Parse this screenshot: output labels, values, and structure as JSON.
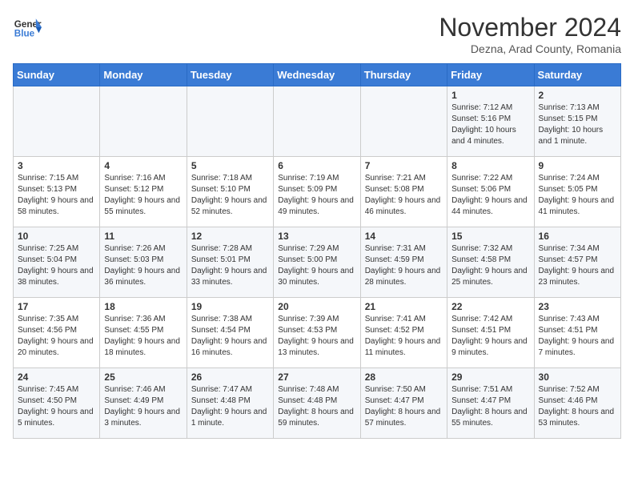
{
  "logo": {
    "general": "General",
    "blue": "Blue"
  },
  "header": {
    "month": "November 2024",
    "location": "Dezna, Arad County, Romania"
  },
  "weekdays": [
    "Sunday",
    "Monday",
    "Tuesday",
    "Wednesday",
    "Thursday",
    "Friday",
    "Saturday"
  ],
  "weeks": [
    [
      {
        "day": "",
        "info": ""
      },
      {
        "day": "",
        "info": ""
      },
      {
        "day": "",
        "info": ""
      },
      {
        "day": "",
        "info": ""
      },
      {
        "day": "",
        "info": ""
      },
      {
        "day": "1",
        "info": "Sunrise: 7:12 AM\nSunset: 5:16 PM\nDaylight: 10 hours and 4 minutes."
      },
      {
        "day": "2",
        "info": "Sunrise: 7:13 AM\nSunset: 5:15 PM\nDaylight: 10 hours and 1 minute."
      }
    ],
    [
      {
        "day": "3",
        "info": "Sunrise: 7:15 AM\nSunset: 5:13 PM\nDaylight: 9 hours and 58 minutes."
      },
      {
        "day": "4",
        "info": "Sunrise: 7:16 AM\nSunset: 5:12 PM\nDaylight: 9 hours and 55 minutes."
      },
      {
        "day": "5",
        "info": "Sunrise: 7:18 AM\nSunset: 5:10 PM\nDaylight: 9 hours and 52 minutes."
      },
      {
        "day": "6",
        "info": "Sunrise: 7:19 AM\nSunset: 5:09 PM\nDaylight: 9 hours and 49 minutes."
      },
      {
        "day": "7",
        "info": "Sunrise: 7:21 AM\nSunset: 5:08 PM\nDaylight: 9 hours and 46 minutes."
      },
      {
        "day": "8",
        "info": "Sunrise: 7:22 AM\nSunset: 5:06 PM\nDaylight: 9 hours and 44 minutes."
      },
      {
        "day": "9",
        "info": "Sunrise: 7:24 AM\nSunset: 5:05 PM\nDaylight: 9 hours and 41 minutes."
      }
    ],
    [
      {
        "day": "10",
        "info": "Sunrise: 7:25 AM\nSunset: 5:04 PM\nDaylight: 9 hours and 38 minutes."
      },
      {
        "day": "11",
        "info": "Sunrise: 7:26 AM\nSunset: 5:03 PM\nDaylight: 9 hours and 36 minutes."
      },
      {
        "day": "12",
        "info": "Sunrise: 7:28 AM\nSunset: 5:01 PM\nDaylight: 9 hours and 33 minutes."
      },
      {
        "day": "13",
        "info": "Sunrise: 7:29 AM\nSunset: 5:00 PM\nDaylight: 9 hours and 30 minutes."
      },
      {
        "day": "14",
        "info": "Sunrise: 7:31 AM\nSunset: 4:59 PM\nDaylight: 9 hours and 28 minutes."
      },
      {
        "day": "15",
        "info": "Sunrise: 7:32 AM\nSunset: 4:58 PM\nDaylight: 9 hours and 25 minutes."
      },
      {
        "day": "16",
        "info": "Sunrise: 7:34 AM\nSunset: 4:57 PM\nDaylight: 9 hours and 23 minutes."
      }
    ],
    [
      {
        "day": "17",
        "info": "Sunrise: 7:35 AM\nSunset: 4:56 PM\nDaylight: 9 hours and 20 minutes."
      },
      {
        "day": "18",
        "info": "Sunrise: 7:36 AM\nSunset: 4:55 PM\nDaylight: 9 hours and 18 minutes."
      },
      {
        "day": "19",
        "info": "Sunrise: 7:38 AM\nSunset: 4:54 PM\nDaylight: 9 hours and 16 minutes."
      },
      {
        "day": "20",
        "info": "Sunrise: 7:39 AM\nSunset: 4:53 PM\nDaylight: 9 hours and 13 minutes."
      },
      {
        "day": "21",
        "info": "Sunrise: 7:41 AM\nSunset: 4:52 PM\nDaylight: 9 hours and 11 minutes."
      },
      {
        "day": "22",
        "info": "Sunrise: 7:42 AM\nSunset: 4:51 PM\nDaylight: 9 hours and 9 minutes."
      },
      {
        "day": "23",
        "info": "Sunrise: 7:43 AM\nSunset: 4:51 PM\nDaylight: 9 hours and 7 minutes."
      }
    ],
    [
      {
        "day": "24",
        "info": "Sunrise: 7:45 AM\nSunset: 4:50 PM\nDaylight: 9 hours and 5 minutes."
      },
      {
        "day": "25",
        "info": "Sunrise: 7:46 AM\nSunset: 4:49 PM\nDaylight: 9 hours and 3 minutes."
      },
      {
        "day": "26",
        "info": "Sunrise: 7:47 AM\nSunset: 4:48 PM\nDaylight: 9 hours and 1 minute."
      },
      {
        "day": "27",
        "info": "Sunrise: 7:48 AM\nSunset: 4:48 PM\nDaylight: 8 hours and 59 minutes."
      },
      {
        "day": "28",
        "info": "Sunrise: 7:50 AM\nSunset: 4:47 PM\nDaylight: 8 hours and 57 minutes."
      },
      {
        "day": "29",
        "info": "Sunrise: 7:51 AM\nSunset: 4:47 PM\nDaylight: 8 hours and 55 minutes."
      },
      {
        "day": "30",
        "info": "Sunrise: 7:52 AM\nSunset: 4:46 PM\nDaylight: 8 hours and 53 minutes."
      }
    ]
  ]
}
